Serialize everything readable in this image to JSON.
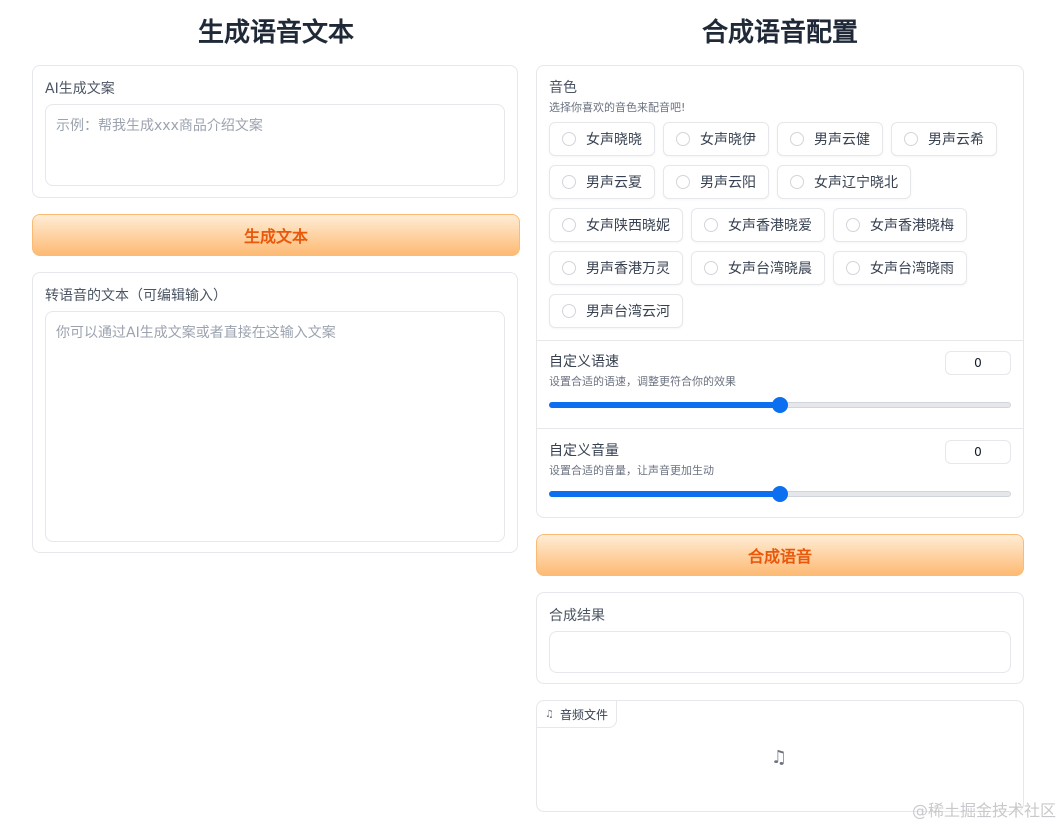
{
  "left": {
    "title": "生成语音文本",
    "ai_copy": {
      "label": "AI生成文案",
      "placeholder": "示例：帮我生成xxx商品介绍文案"
    },
    "generate_button": "生成文本",
    "tts_text": {
      "label": "转语音的文本（可编辑输入）",
      "placeholder": "你可以通过AI生成文案或者直接在这输入文案"
    }
  },
  "right": {
    "title": "合成语音配置",
    "voice": {
      "label": "音色",
      "hint": "选择你喜欢的音色来配音吧!",
      "options": [
        "女声晓晓",
        "女声晓伊",
        "男声云健",
        "男声云希",
        "男声云夏",
        "男声云阳",
        "女声辽宁晓北",
        "女声陕西晓妮",
        "女声香港晓爱",
        "女声香港晓梅",
        "男声香港万灵",
        "女声台湾晓晨",
        "女声台湾晓雨",
        "男声台湾云河"
      ]
    },
    "speed": {
      "label": "自定义语速",
      "hint": "设置合适的语速，调整更符合你的效果",
      "value": "0",
      "slider_fraction": 0.5
    },
    "volume": {
      "label": "自定义音量",
      "hint": "设置合适的音量，让声音更加生动",
      "value": "0",
      "slider_fraction": 0.5
    },
    "synthesize_button": "合成语音",
    "result": {
      "label": "合成结果"
    },
    "audio": {
      "tab_label": "音频文件",
      "icon": "music-note-icon"
    }
  },
  "watermark": "@稀土掘金技术社区",
  "colors": {
    "accent": "#ea580c",
    "slider": "#0b6ff0",
    "button_from": "#ffedd5",
    "button_to": "#fdba74"
  }
}
